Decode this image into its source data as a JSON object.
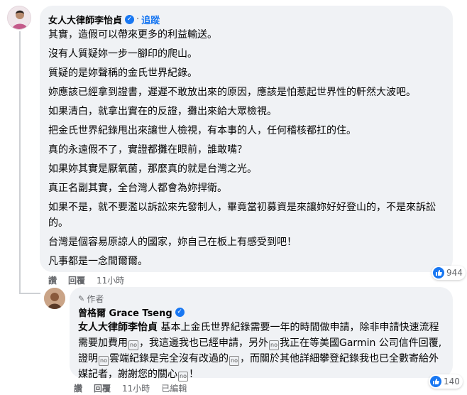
{
  "comment1": {
    "author": "女人大律師李怡貞",
    "follow_label": "追蹤",
    "paragraphs": [
      "其實，造假可以帶來更多的利益輸送。",
      "沒有人質疑妳一步一腳印的爬山。",
      "質疑的是妳聲稱的金氏世界紀錄。",
      "妳應該已經拿到證書，遲遲不敢放出來的原因，應該是怕惹起世界性的軒然大波吧。",
      "如果清白，就拿出實在的反證，攤出來給大眾檢視。",
      "把金氏世界紀錄甩出來讓世人檢視，有本事的人，任何稽核都扛的住。",
      "真的永遠假不了，實證都攤在眼前，誰敢嘴？",
      "如果妳其實是厭氧菌，那麼真的就是台灣之光。",
      "真正名副其實，全台灣人都會為妳捍衛。",
      "如果不是，就不要濫以訴訟來先發制人，畢竟當初募資是來讓妳好好登山的，不是來訴訟的。",
      "台灣是個容易原諒人的國家，妳自己在板上有感受到吧！",
      "凡事都是一念間爾爾。"
    ],
    "actions": {
      "like": "讚",
      "reply": "回覆",
      "time": "11小時"
    },
    "reaction_count": "944"
  },
  "reply": {
    "author_tag": "作者",
    "author": "曾格爾 Grace Tseng",
    "mention": "女人大律師李怡貞",
    "text_a": " 基本上金氏世界紀錄需要一年的時間做申請，除非申請快速流程需要加費用",
    "text_b": "，我這邊我也已經申請，另外",
    "text_c": "我正在等美國Garmin 公司信件回覆,證明",
    "text_d": "雲端紀錄是完全沒有改過的",
    "text_e": "，而關於其他詳細攀登紀錄我也已全數寄給外媒記者，謝謝您的關心",
    "text_f": "！",
    "emoji_label": "no",
    "actions": {
      "like": "讚",
      "reply": "回覆",
      "time": "11小時",
      "edited": "已編輯"
    },
    "reaction_count": "140"
  },
  "colors": {
    "accent": "#1877f2",
    "bubble": "#f0f2f5",
    "meta": "#65676b"
  }
}
